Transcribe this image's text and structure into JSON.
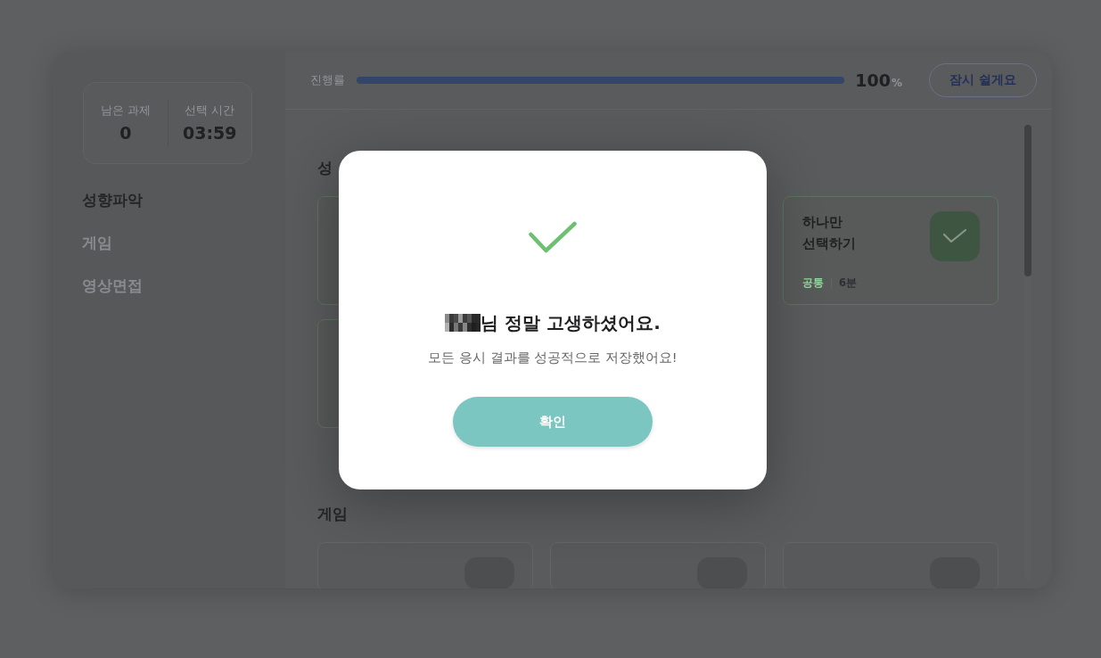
{
  "sidebar": {
    "stats": [
      {
        "label": "남은 과제",
        "value": "0"
      },
      {
        "label": "선택 시간",
        "value": "03:59"
      }
    ],
    "nav": [
      {
        "label": "성향파악",
        "selected": true
      },
      {
        "label": "게임",
        "selected": false
      },
      {
        "label": "영상면접",
        "selected": false
      }
    ]
  },
  "progress": {
    "label": "진행률",
    "level": 1,
    "value": "100",
    "unit": "%"
  },
  "pause_button": "잠시 쉴게요",
  "sections": [
    {
      "title": "성",
      "rows": [
        [
          {
            "completed": true,
            "tile": false
          },
          {
            "completed": true,
            "tile": true,
            "title": "하나만\n선택하기",
            "tag": "공통",
            "duration": "6분"
          }
        ],
        [
          {
            "completed": true,
            "tile": false
          }
        ]
      ]
    },
    {
      "title": "게임",
      "rows": [
        [
          {
            "completed": false,
            "tile": true
          },
          {
            "completed": false,
            "tile": true
          },
          {
            "completed": false,
            "tile": true
          }
        ]
      ]
    }
  ],
  "modal": {
    "title": "님 정말 고생하셨어요.",
    "message": "모든 응시 결과를 성공적으로 저장했어요!",
    "button": "확인"
  }
}
